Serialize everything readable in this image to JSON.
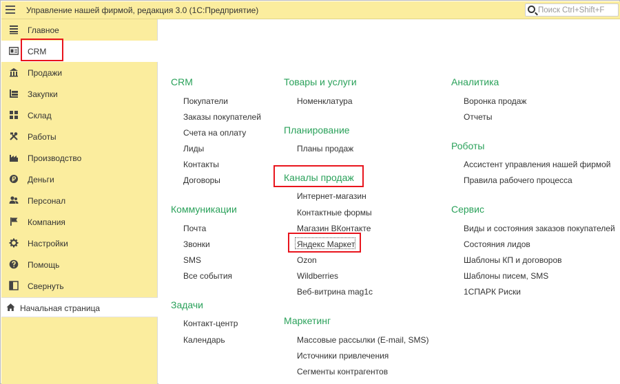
{
  "titlebar": {
    "title": "Управление нашей фирмой, редакция 3.0  (1С:Предприятие)",
    "search_placeholder": "Поиск Ctrl+Shift+F"
  },
  "sidebar": {
    "items": [
      {
        "label": "Главное",
        "icon": "menu-lines-icon"
      },
      {
        "label": "CRM",
        "icon": "crm-card-icon"
      },
      {
        "label": "Продажи",
        "icon": "shop-icon"
      },
      {
        "label": "Закупки",
        "icon": "cart-icon"
      },
      {
        "label": "Склад",
        "icon": "warehouse-icon"
      },
      {
        "label": "Работы",
        "icon": "tools-icon"
      },
      {
        "label": "Производство",
        "icon": "factory-icon"
      },
      {
        "label": "Деньги",
        "icon": "coin-icon"
      },
      {
        "label": "Персонал",
        "icon": "people-icon"
      },
      {
        "label": "Компания",
        "icon": "flag-icon"
      },
      {
        "label": "Настройки",
        "icon": "gear-icon"
      },
      {
        "label": "Помощь",
        "icon": "help-icon"
      },
      {
        "label": "Свернуть",
        "icon": "collapse-icon"
      }
    ],
    "home": "Начальная страница"
  },
  "main": {
    "col1": {
      "crm": {
        "title": "CRM",
        "items": [
          "Покупатели",
          "Заказы покупателей",
          "Счета на оплату",
          "Лиды",
          "Контакты",
          "Договоры"
        ]
      },
      "comm": {
        "title": "Коммуникации",
        "items": [
          "Почта",
          "Звонки",
          "SMS",
          "Все события"
        ]
      },
      "tasks": {
        "title": "Задачи",
        "items": [
          "Контакт-центр",
          "Календарь"
        ]
      }
    },
    "col2": {
      "goods": {
        "title": "Товары и услуги",
        "items": [
          "Номенклатура"
        ]
      },
      "plan": {
        "title": "Планирование",
        "items": [
          "Планы продаж"
        ]
      },
      "channels": {
        "title": "Каналы продаж",
        "items": [
          "Интернет-магазин",
          "Контактные формы",
          "Магазин ВКонтакте",
          "Яндекс Маркет",
          "Ozon",
          "Wildberries",
          "Веб-витрина mag1c"
        ]
      },
      "marketing": {
        "title": "Маркетинг",
        "items": [
          "Массовые рассылки (E-mail, SMS)",
          "Источники привлечения",
          "Сегменты контрагентов"
        ]
      }
    },
    "col3": {
      "analytics": {
        "title": "Аналитика",
        "items": [
          "Воронка продаж",
          "Отчеты"
        ]
      },
      "robots": {
        "title": "Роботы",
        "items": [
          "Ассистент управления нашей фирмой",
          "Правила рабочего процесса"
        ]
      },
      "service": {
        "title": "Сервис",
        "items": [
          "Виды и состояния заказов покупателей",
          "Состояния лидов",
          "Шаблоны КП и договоров",
          "Шаблоны писем, SMS",
          "1СПАРК Риски"
        ]
      }
    }
  },
  "colors": {
    "accent_green": "#2aa15a",
    "sidebar_bg": "#fbed9e",
    "highlight_red": "#e8141c"
  }
}
